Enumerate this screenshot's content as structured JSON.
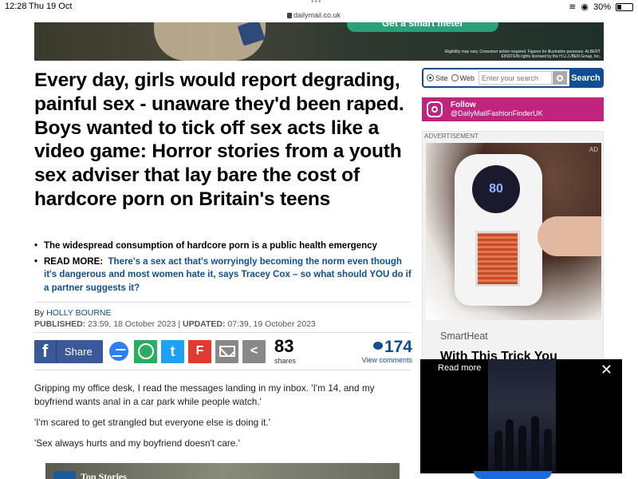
{
  "status": {
    "time": "12:28",
    "date": "Thu 19 Oct",
    "url": "dailymail.co.uk",
    "battery": "30%",
    "battery_level": 0.3
  },
  "banner": {
    "cta": "Get a smart meter",
    "fine_print": "Eligibility may vary. Consumer action required. Figures for illustrative purposes. ALBERT EINSTEIN rights licensed by the H.U.J./BEN Group, Inc."
  },
  "article": {
    "headline": "Every day, girls would report degrading, painful sex - unaware they'd been raped. Boys wanted to tick off sex acts like a video game: Horror stories from a youth sex adviser that lay bare the cost of hardcore porn on Britain's teens",
    "bullets": [
      {
        "text": "The widespread consumption of hardcore porn is a public health emergency"
      },
      {
        "prefix": "READ MORE:",
        "link": "There's a sex act that's worryingly becoming the norm even though it's dangerous and most women hate it, says Tracey Cox – so what should YOU do if a partner suggests it?"
      }
    ],
    "byline_prefix": "By",
    "author": "HOLLY BOURNE",
    "published_label": "PUBLISHED:",
    "published": "23:59, 18 October 2023",
    "separator": "|",
    "updated_label": "UPDATED:",
    "updated": "07:39, 19 October 2023",
    "paragraphs": [
      "Gripping my office desk, I read the messages landing in my inbox. 'I'm 14, and my boyfriend wants anal in a car park while people watch.'",
      "'I'm scared to get strangled but everyone else is doing it.'",
      "'Sex always hurts and my boyfriend doesn't care.'"
    ],
    "top_stories": "Top Stories"
  },
  "share": {
    "facebook_label": "Share",
    "facebook_glyph": "f",
    "twitter_glyph": "t",
    "flipboard_glyph": "F",
    "share_glyph": "<",
    "count": "83",
    "count_label": "shares",
    "comments_count": "174",
    "comments_label": "View comments"
  },
  "sidebar": {
    "search": {
      "option_site": "Site",
      "option_web": "Web",
      "placeholder": "Enter your search",
      "button": "Search"
    },
    "instagram": {
      "title": "Follow",
      "handle": "@DailyMailFashionFinderUK"
    },
    "ad": {
      "label": "ADVERTISEMENT",
      "badge": "AD",
      "display_value": "80",
      "brand": "SmartHeat",
      "headline": "With This Trick You"
    }
  },
  "video": {
    "read_more": "Read more",
    "close": "✕"
  }
}
